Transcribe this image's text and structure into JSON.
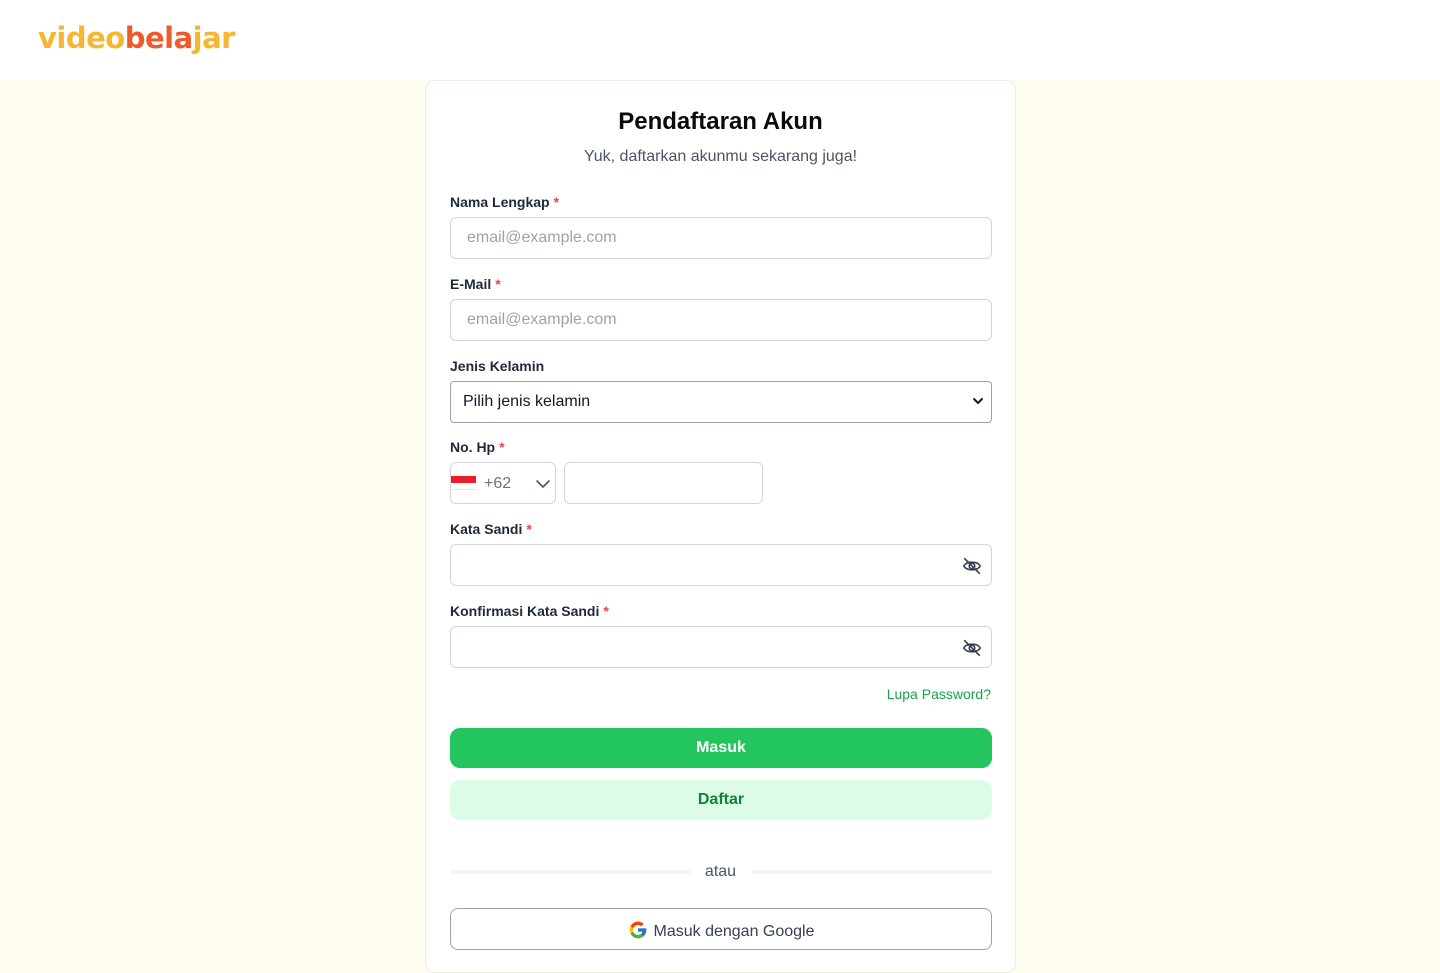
{
  "header": {
    "logo_part1": "video",
    "logo_part2": "bela",
    "logo_part3": "jar"
  },
  "form": {
    "title": "Pendaftaran Akun",
    "subtitle": "Yuk, daftarkan akunmu sekarang juga!",
    "fields": {
      "full_name": {
        "label": "Nama Lengkap",
        "required_mark": "*",
        "placeholder": "email@example.com",
        "value": ""
      },
      "email": {
        "label": "E-Mail",
        "required_mark": "*",
        "placeholder": "email@example.com",
        "value": ""
      },
      "gender": {
        "label": "Jenis Kelamin",
        "selected": "Pilih jenis kelamin"
      },
      "phone": {
        "label": "No. Hp",
        "required_mark": "*",
        "country_code": "+62",
        "country_flag": "indonesia-flag",
        "value": ""
      },
      "password": {
        "label": "Kata Sandi",
        "required_mark": "*",
        "value": "",
        "icon": "eye-off-icon"
      },
      "confirm_password": {
        "label": "Konfirmasi Kata Sandi",
        "required_mark": "*",
        "value": "",
        "icon": "eye-off-icon"
      }
    },
    "forgot_password": "Lupa Password?",
    "login_button": "Masuk",
    "register_button": "Daftar",
    "divider_text": "atau",
    "google_button": "Masuk dengan Google"
  },
  "colors": {
    "primary": "#22c55e",
    "primary_light": "#dcfce7",
    "primary_dark": "#15803d",
    "background": "#fffdf0",
    "logo_yellow": "#f5b731",
    "logo_orange": "#ee5a2b",
    "required": "#ef4444"
  }
}
